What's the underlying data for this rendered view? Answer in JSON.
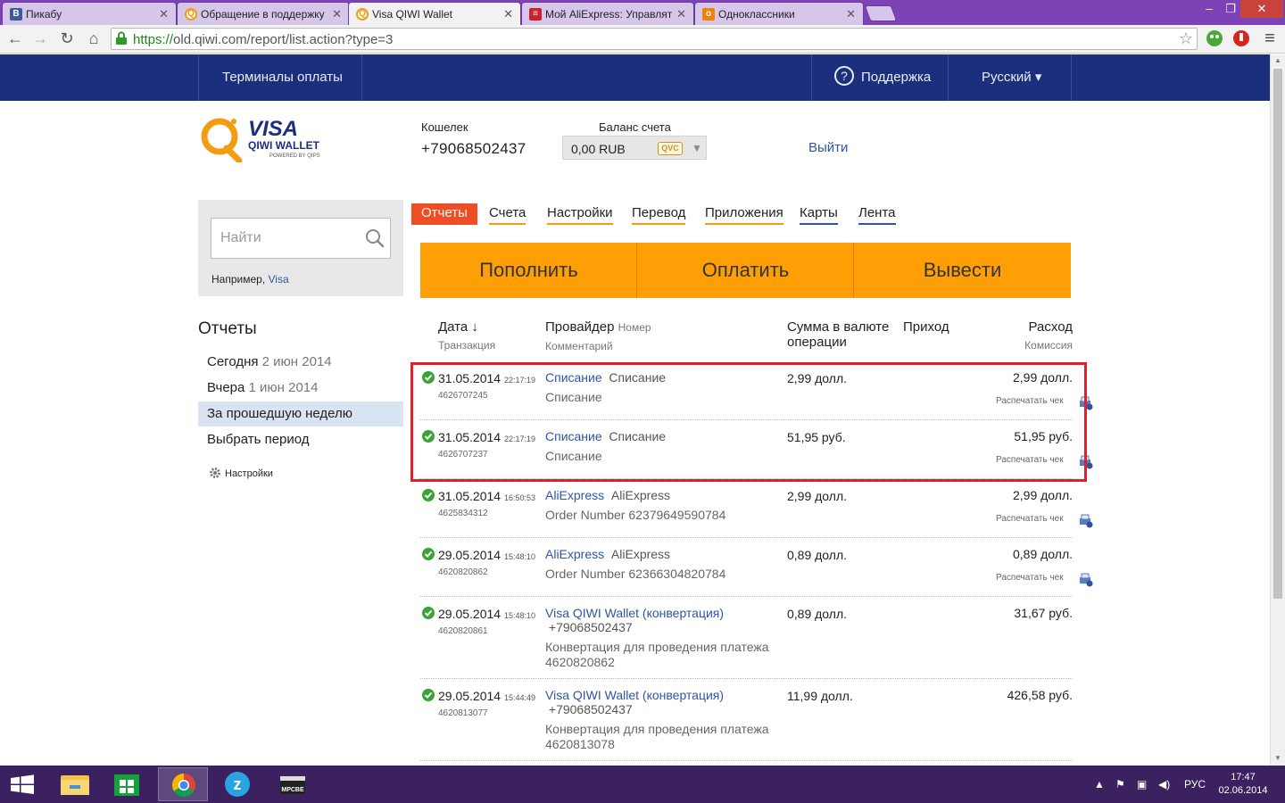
{
  "browser": {
    "tabs": [
      {
        "title": "Пикабу",
        "favicon": "pikabu-icon",
        "color": "#3c5a99"
      },
      {
        "title": "Обращение в поддержку",
        "favicon": "qiwi-icon",
        "color": "#f39c12"
      },
      {
        "title": "Visa QIWI Wallet",
        "favicon": "qiwi-icon",
        "color": "#f39c12"
      },
      {
        "title": "Мой AliExpress: Управлят",
        "favicon": "aliexpress-icon",
        "color": "#d01e2f"
      },
      {
        "title": "Одноклассники",
        "favicon": "ok-icon",
        "color": "#ee8208"
      }
    ],
    "url_scheme": "https://",
    "url_rest": "old.qiwi.com/report/list.action?type=3"
  },
  "site_nav": {
    "terminals": "Терминалы оплаты",
    "support": "Поддержка",
    "language": "Русский ▾"
  },
  "account": {
    "wallet_label": "Кошелек",
    "wallet_number": "+79068502437",
    "balance_label": "Баланс счета",
    "balance_value": "0,00 RUB",
    "currency_badge": "QVC",
    "logout": "Выйти"
  },
  "logo": {
    "line1": "VISA",
    "line2": "QIWI WALLET",
    "line3": "POWERED BY QIPS"
  },
  "search": {
    "placeholder": "Найти",
    "example_prefix": "Например, ",
    "example_link": "Visa"
  },
  "sidebar": {
    "title": "Отчеты",
    "items": [
      {
        "label": "Сегодня",
        "date": "2 июн 2014"
      },
      {
        "label": "Вчера",
        "date": "1 июн 2014"
      },
      {
        "label": "За прошедшую неделю",
        "date": ""
      },
      {
        "label": "Выбрать период",
        "date": ""
      }
    ],
    "settings": "Настройки"
  },
  "tabs": [
    "Отчеты",
    "Счета",
    "Настройки",
    "Перевод",
    "Приложения",
    "Карты",
    "Лента"
  ],
  "actions": [
    "Пополнить",
    "Оплатить",
    "Вывести"
  ],
  "table": {
    "headers": {
      "date": "Дата ↓",
      "date_sub": "Транзакция",
      "provider": "Провайдер",
      "provider_num": "Номер",
      "provider_sub": "Комментарий",
      "amount": "Сумма в валюте операции",
      "income": "Приход",
      "expense": "Расход",
      "expense_sub": "Комиссия"
    },
    "print_label": "Распечатать чек",
    "rows": [
      {
        "date": "31.05.2014",
        "time": "22:17:19",
        "txid": "4626707245",
        "provider": "Списание",
        "number": "Списание",
        "comment": "Списание",
        "amount": "2,99 долл.",
        "expense": "2,99 долл.",
        "print": true
      },
      {
        "date": "31.05.2014",
        "time": "22:17:19",
        "txid": "4626707237",
        "provider": "Списание",
        "number": "Списание",
        "comment": "Списание",
        "amount": "51,95 руб.",
        "expense": "51,95 руб.",
        "print": true
      },
      {
        "date": "31.05.2014",
        "time": "16:50:53",
        "txid": "4625834312",
        "provider": "AliExpress",
        "number": "AliExpress",
        "comment": "Order Number 62379649590784",
        "amount": "2,99 долл.",
        "expense": "2,99 долл.",
        "print": true
      },
      {
        "date": "29.05.2014",
        "time": "15:48:10",
        "txid": "4620820862",
        "provider": "AliExpress",
        "number": "AliExpress",
        "comment": "Order Number 62366304820784",
        "amount": "0,89 долл.",
        "expense": "0,89 долл.",
        "print": true
      },
      {
        "date": "29.05.2014",
        "time": "15:48:10",
        "txid": "4620820861",
        "provider": "Visa QIWI Wallet (конвертация)",
        "number": "+79068502437",
        "comment": "Конвертация для проведения платежа 4620820862",
        "amount": "0,89 долл.",
        "expense": "31,67 руб.",
        "print": false
      },
      {
        "date": "29.05.2014",
        "time": "15:44:49",
        "txid": "4620813077",
        "provider": "Visa QIWI Wallet (конвертация)",
        "number": "+79068502437",
        "comment": "Конвертация для проведения платежа 4620813078",
        "amount": "11,99 долл.",
        "expense": "426,58 руб.",
        "print": false
      }
    ]
  },
  "taskbar": {
    "lang": "РУС",
    "time": "17:47",
    "date": "02.06.2014"
  },
  "colors": {
    "site_nav_bg": "#1c2f7d",
    "accent_orange": "#ff9f05",
    "active_tab": "#ef4d24",
    "link_blue": "#2f55a4",
    "highlight_red": "#e0202a"
  }
}
